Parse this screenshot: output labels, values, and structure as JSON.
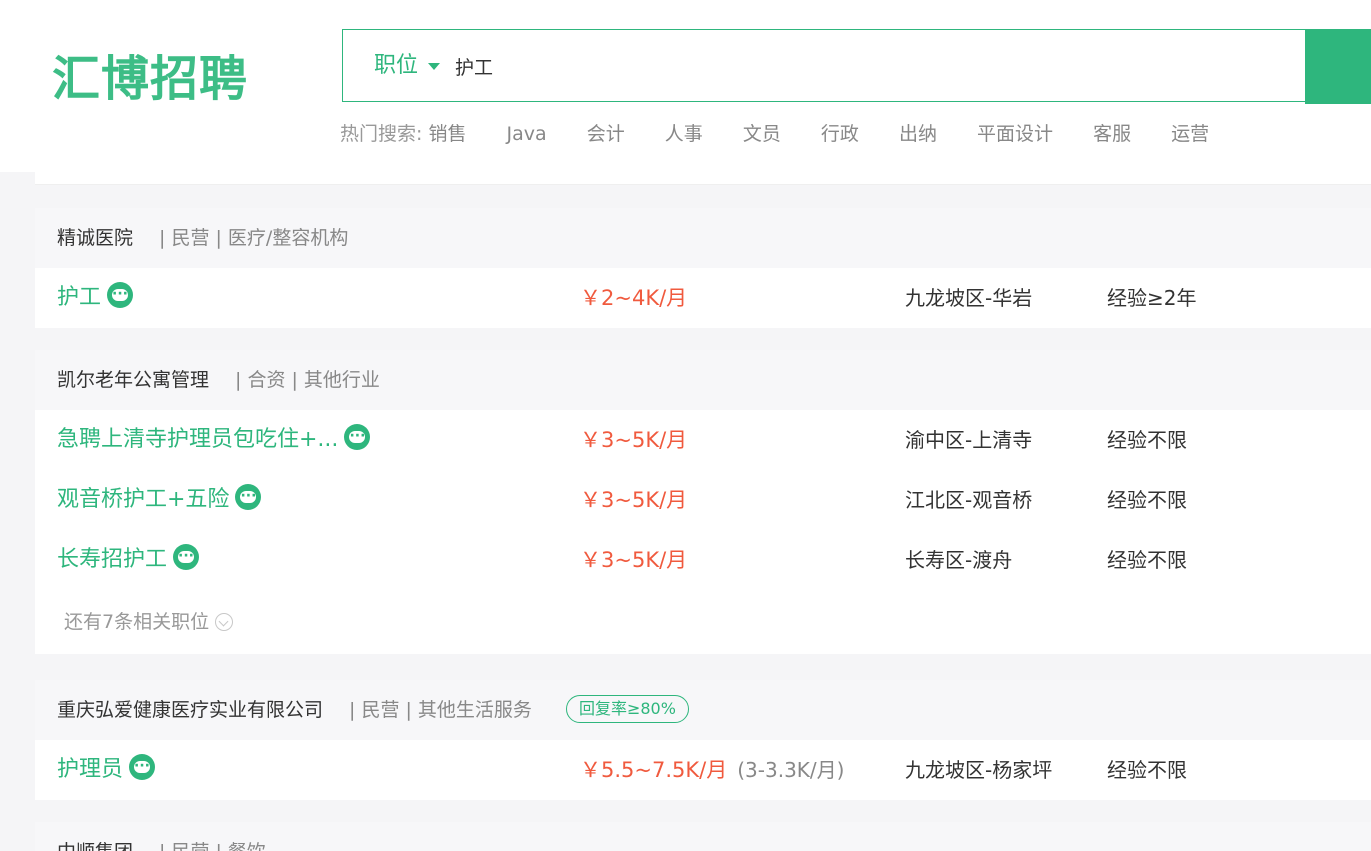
{
  "header": {
    "logo": "汇博招聘",
    "search_type": "职位",
    "search_value": "护工",
    "hot_label": "热门搜索:",
    "hot_items": [
      "销售",
      "Java",
      "会计",
      "人事",
      "文员",
      "行政",
      "出纳",
      "平面设计",
      "客服",
      "运营"
    ]
  },
  "results": [
    {
      "company": "精诚医院",
      "meta": "| 民营 | 医疗/整容机构",
      "jobs": [
        {
          "title": "护工",
          "salary": "￥2~4K/月",
          "location": "九龙坡区-华岩",
          "experience": "经验≥2年"
        }
      ]
    },
    {
      "company": "凯尔老年公寓管理",
      "meta": "| 合资 | 其他行业",
      "jobs": [
        {
          "title": "急聘上清寺护理员包吃住+...",
          "salary": "￥3~5K/月",
          "location": "渝中区-上清寺",
          "experience": "经验不限"
        },
        {
          "title": "观音桥护工+五险",
          "salary": "￥3~5K/月",
          "location": "江北区-观音桥",
          "experience": "经验不限"
        },
        {
          "title": "长寿招护工",
          "salary": "￥3~5K/月",
          "location": "长寿区-渡舟",
          "experience": "经验不限"
        }
      ],
      "more": "还有7条相关职位"
    },
    {
      "company": "重庆弘爱健康医疗实业有限公司",
      "meta": "| 民营 | 其他生活服务",
      "rate_badge": "回复率≥80%",
      "jobs": [
        {
          "title": "护理员",
          "salary": "￥5.5~7.5K/月",
          "salary_sub": "(3-3.3K/月)",
          "location": "九龙坡区-杨家坪",
          "experience": "经验不限"
        }
      ]
    },
    {
      "company": "中顺集团",
      "meta": "| 民营 | 餐饮",
      "jobs": []
    }
  ],
  "colors": {
    "brand": "#2eb67d",
    "salary": "#f05a3e"
  }
}
